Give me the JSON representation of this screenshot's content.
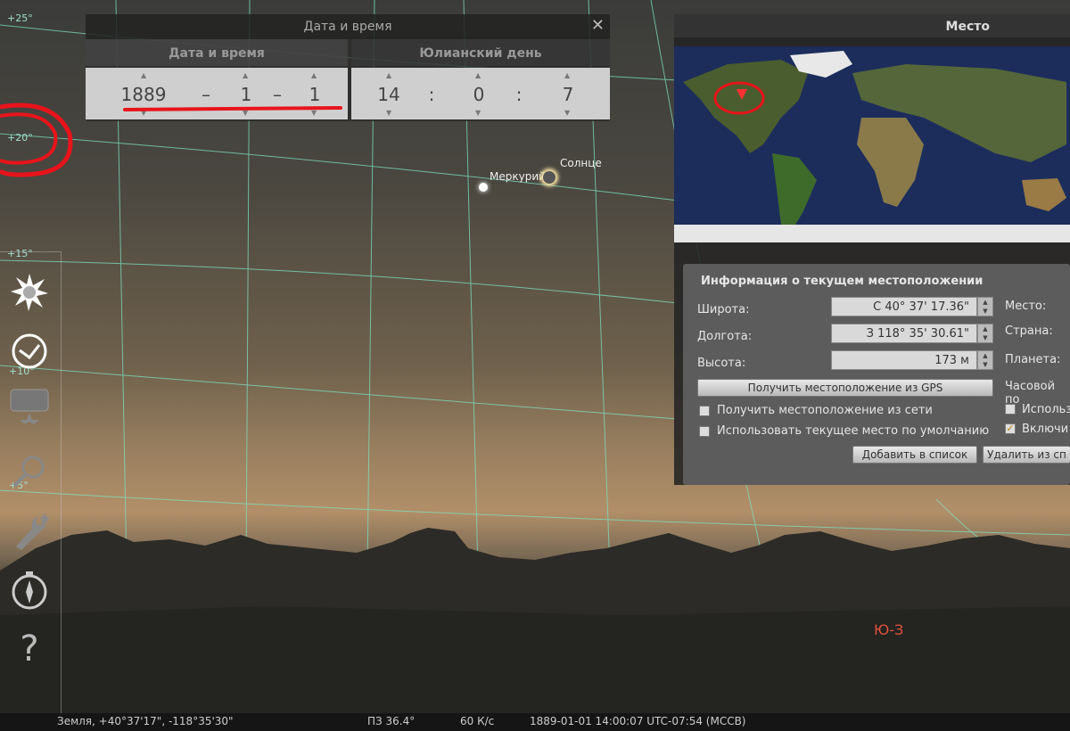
{
  "datetime_panel": {
    "title": "Дата и время",
    "tab_datetime": "Дата и время",
    "tab_julian": "Юлианский день",
    "year": "1889",
    "sep1": "–",
    "month": "1",
    "sep2": "–",
    "day": "1",
    "hour": "14",
    "colon1": ":",
    "minute": "0",
    "colon2": ":",
    "second": "7",
    "close": "✕"
  },
  "location_panel": {
    "title": "Место",
    "info_title": "Информация о текущем местоположении",
    "lat_label": "Широта:",
    "lat_value": "С 40° 37' 17.36\"",
    "lon_label": "Долгота:",
    "lon_value": "З 118° 35' 30.61\"",
    "alt_label": "Высота:",
    "alt_value": "173 м",
    "gps_button": "Получить местоположение из GPS",
    "net_checkbox": "Получить местоположение из сети",
    "default_checkbox": "Использовать текущее место по умолчанию",
    "add_button": "Добавить в список",
    "remove_button": "Удалить из сп",
    "place_label": "Место:",
    "country_label": "Страна:",
    "planet_label": "Планета:",
    "timezone_label": "Часовой по",
    "use_label": "Использ",
    "enable_label": "Включи"
  },
  "sky": {
    "grid_labels": [
      "+25°",
      "+20°",
      "+15°",
      "+10°",
      "+5°"
    ],
    "sun_label": "Солнце",
    "mercury_label": "Меркурий",
    "direction_label": "Ю-З"
  },
  "toolbar_icons": [
    "sky-brightness-icon",
    "clock-icon",
    "location-window-icon",
    "search-icon",
    "settings-icon",
    "compass-icon",
    "help-icon"
  ],
  "help_glyph": "?",
  "status_bar": {
    "location": "Земля, +40°37'17\", -118°35'30\"",
    "fov": "ПЗ 36.4°",
    "fps": "60 К/с",
    "datetime": "1889-01-01 14:00:07 UTC-07:54 (МССВ)"
  },
  "colors": {
    "grid": "#7fe0c0",
    "annotation_red": "#e8141b",
    "direction": "#e0533a"
  }
}
